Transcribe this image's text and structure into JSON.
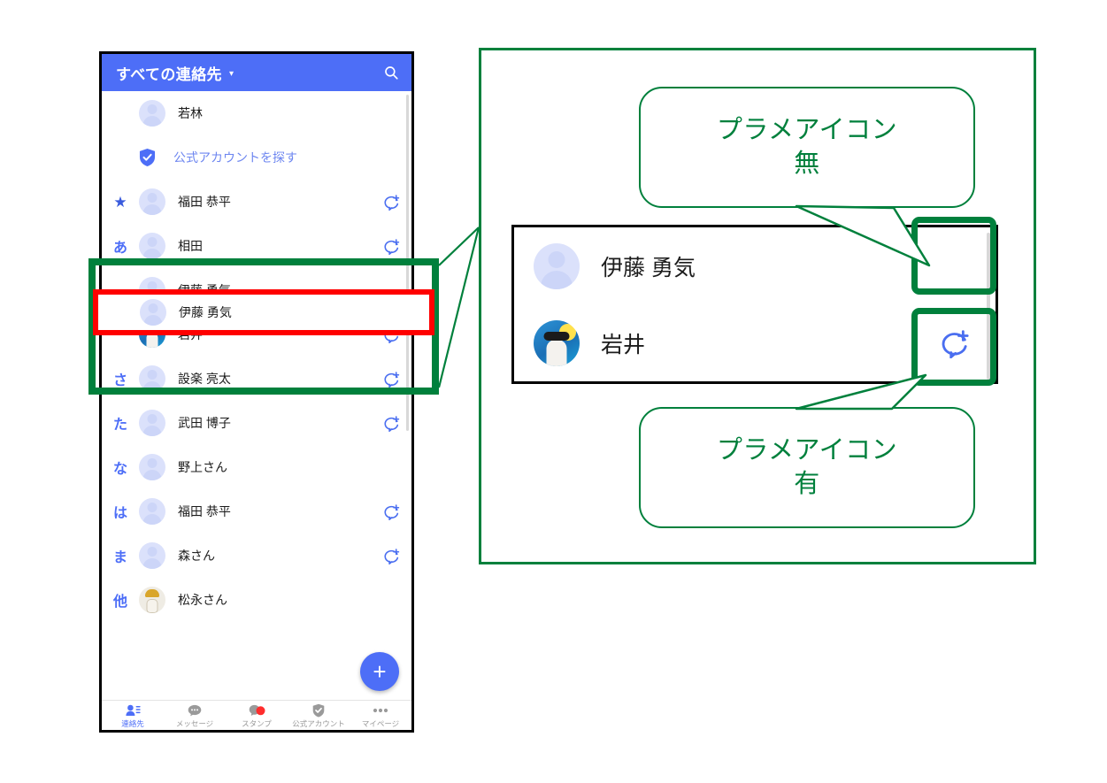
{
  "phone": {
    "header": {
      "title": "すべての連絡先",
      "caret": "▾",
      "search_icon": "search-icon"
    },
    "rows": [
      {
        "kana": "",
        "name": "若林",
        "avatar": "placeholder",
        "action": ""
      },
      {
        "kana": "",
        "name": "公式アカウントを探す",
        "avatar": "shield",
        "action": "",
        "type": "official"
      },
      {
        "kana": "★",
        "name": "福田 恭平",
        "avatar": "placeholder",
        "action": "chat-add-icon"
      },
      {
        "kana": "あ",
        "name": "相田",
        "avatar": "placeholder",
        "action": "chat-add-icon"
      },
      {
        "kana": "",
        "name": "伊藤 勇気",
        "avatar": "placeholder",
        "action": ""
      },
      {
        "kana": "",
        "name": "岩井",
        "avatar": "dog-blue",
        "action": "chat-add-icon"
      },
      {
        "kana": "さ",
        "name": "設楽 亮太",
        "avatar": "placeholder",
        "action": "chat-add-icon"
      },
      {
        "kana": "た",
        "name": "武田 博子",
        "avatar": "placeholder",
        "action": "chat-add-icon"
      },
      {
        "kana": "な",
        "name": "野上さん",
        "avatar": "placeholder",
        "action": ""
      },
      {
        "kana": "は",
        "name": "福田 恭平",
        "avatar": "placeholder",
        "action": "chat-add-icon"
      },
      {
        "kana": "ま",
        "name": "森さん",
        "avatar": "placeholder",
        "action": "chat-add-icon"
      },
      {
        "kana": "他",
        "name": "松永さん",
        "avatar": "dog-gold",
        "action": ""
      }
    ],
    "fab": {
      "label": "+"
    },
    "tabs": [
      {
        "label": "連絡先",
        "icon": "contacts-icon",
        "active": true
      },
      {
        "label": "メッセージ",
        "icon": "message-icon",
        "active": false
      },
      {
        "label": "スタンプ",
        "icon": "sticker-icon",
        "active": false
      },
      {
        "label": "公式アカウント",
        "icon": "official-shield-icon",
        "active": false
      },
      {
        "label": "マイページ",
        "icon": "more-icon",
        "active": false
      }
    ]
  },
  "panel": {
    "detail_rows": [
      {
        "name": "伊藤 勇気",
        "avatar": "placeholder",
        "action": ""
      },
      {
        "name": "岩井",
        "avatar": "dog-blue",
        "action": "chat-add-icon"
      }
    ],
    "callouts": [
      {
        "line1": "プラメアイコン",
        "line2": "無"
      },
      {
        "line1": "プラメアイコン",
        "line2": "有"
      }
    ]
  },
  "colors": {
    "header_blue": "#4d6ef7",
    "accent_blue": "#4a6ef0",
    "annotation_green": "#00803c",
    "highlight_red": "#ff0000",
    "avatar_placeholder": "#dbe1fb"
  }
}
